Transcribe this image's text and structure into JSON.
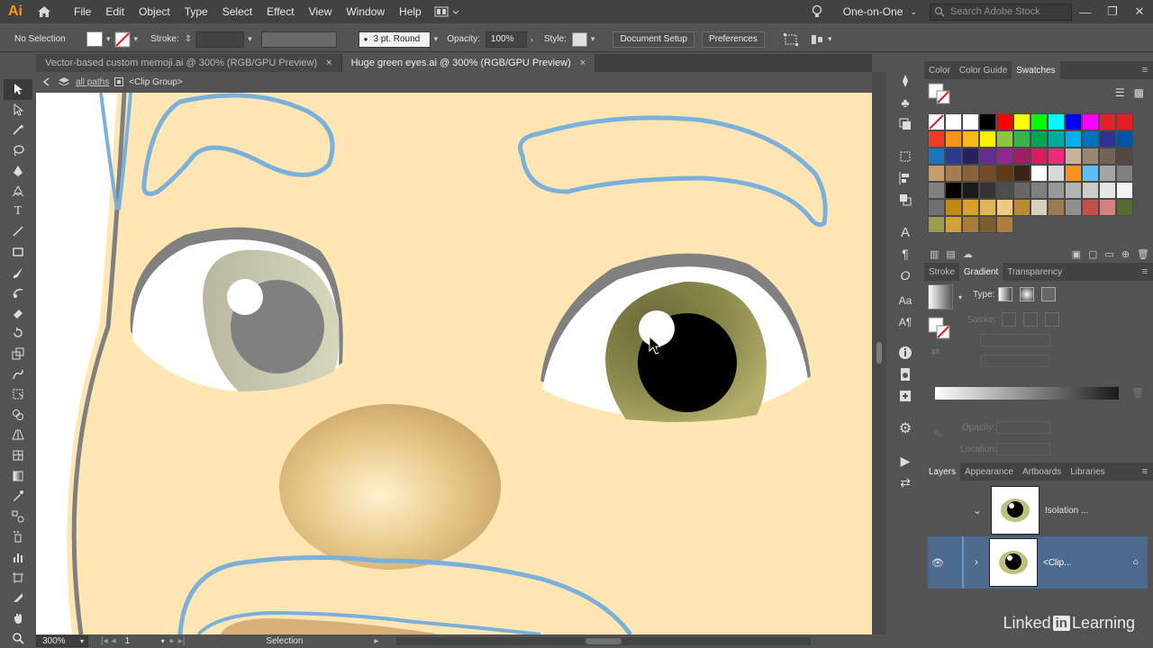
{
  "app": {
    "logo": "Ai",
    "workspace": "One-on-One",
    "search_placeholder": "Search Adobe Stock"
  },
  "menu": [
    "File",
    "Edit",
    "Object",
    "Type",
    "Select",
    "Effect",
    "View",
    "Window",
    "Help"
  ],
  "controlbar": {
    "selection": "No Selection",
    "stroke_label": "Stroke:",
    "brush": "3 pt. Round",
    "opacity_label": "Opacity:",
    "opacity_value": "100%",
    "style_label": "Style:",
    "document_setup": "Document Setup",
    "preferences": "Preferences"
  },
  "tabs": [
    {
      "label": "Vector-based custom memoji.ai @ 300% (RGB/GPU Preview)",
      "close": "×"
    },
    {
      "label": "Huge green eyes.ai @ 300% (RGB/GPU Preview)",
      "close": "×"
    }
  ],
  "breadcrumb": {
    "level1": "all paths",
    "level2": "<Clip Group>"
  },
  "statusbar": {
    "zoom": "300%",
    "artboard": "1",
    "tool": "Selection"
  },
  "panels": {
    "top_tabs": [
      "Color",
      "Color Guide",
      "Swatches"
    ],
    "active_top": "Swatches",
    "mid_tabs": [
      "Stroke",
      "Gradient",
      "Transparency"
    ],
    "active_mid": "Gradient",
    "gradient": {
      "type_label": "Type:",
      "stroke_label": "Stroke:",
      "opacity_label": "Opacity:",
      "location_label": "Location:"
    },
    "bottom_tabs": [
      "Layers",
      "Appearance",
      "Artboards",
      "Libraries"
    ],
    "active_bottom": "Layers",
    "layers": [
      {
        "name": "Isolation ..."
      },
      {
        "name": "<Clip..."
      }
    ]
  },
  "swatch_colors": [
    "#ffffff",
    "#ffffff",
    "#ffffff",
    "#000000",
    "#ff0000",
    "#ffff00",
    "#00ff00",
    "#00ffff",
    "#0000ff",
    "#ff00ff",
    "#e0202a",
    "#e61c23",
    "#f03c24",
    "#f7941d",
    "#fdb813",
    "#fff200",
    "#8dc63f",
    "#39b54a",
    "#00a651",
    "#00a99d",
    "#00aeef",
    "#0072bc",
    "#2e3192",
    "#0054a6",
    "#1b75bc",
    "#2b3990",
    "#262262",
    "#662d91",
    "#92278f",
    "#9e1f63",
    "#da1c5c",
    "#ee2a7b",
    "#c7b299",
    "#998675",
    "#736357",
    "#534741",
    "#c69c6d",
    "#a67c52",
    "#8c6239",
    "#754c24",
    "#603913",
    "#3c2415",
    "#ffffff",
    "#d9d9d9",
    "#f7941d",
    "#5bc0eb",
    "#a6a6a6",
    "#808080",
    "#808080",
    "#000000",
    "#1a1a1a",
    "#333333",
    "#4d4d4d",
    "#666666",
    "#808080",
    "#999999",
    "#b3b3b3",
    "#cccccc",
    "#e6e6e6",
    "#f2f2f2",
    "#707070",
    "#c38a13",
    "#d9a12a",
    "#e0b65a",
    "#f0c987",
    "#b88a3a",
    "#d8d0c0",
    "#9b7b55",
    "#8f8f8f",
    "#c0504d",
    "#d68080",
    "#556b2f",
    "#9b9b52",
    "#d4a23a",
    "#a77d37",
    "#7a5c2e",
    "#b07b3c"
  ],
  "watermark": {
    "prefix": "Linked",
    "badge": "in",
    "suffix": " Learning"
  }
}
